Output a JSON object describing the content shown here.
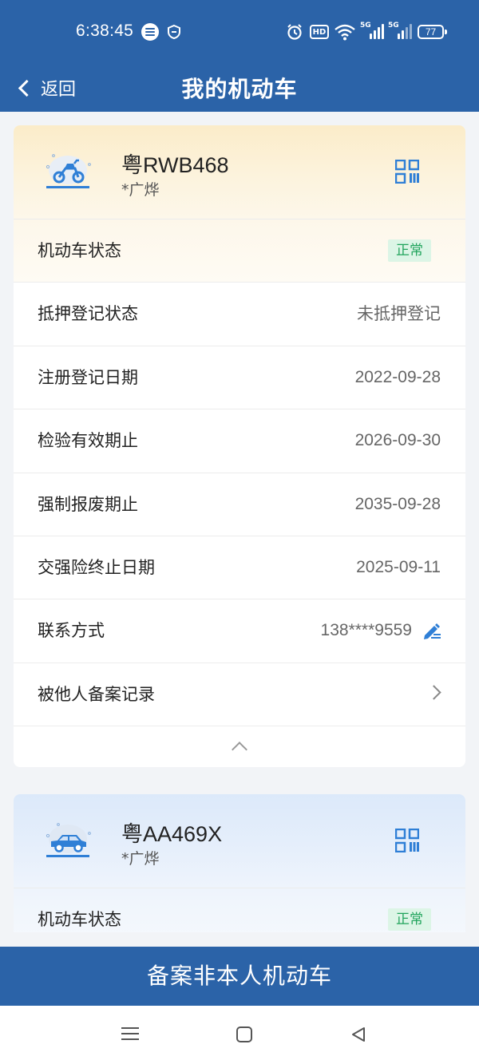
{
  "status_bar": {
    "time": "6:38:45",
    "hd_label": "HD",
    "signal1_label": "5G",
    "signal2_label": "5G",
    "battery": "77"
  },
  "nav": {
    "back_label": "返回",
    "title": "我的机动车"
  },
  "vehicles": [
    {
      "plate": "粤RWB468",
      "owner": "*广烨",
      "icon": "motorcycle-icon",
      "rows": [
        {
          "label": "机动车状态",
          "badge": "正常"
        },
        {
          "label": "抵押登记状态",
          "value": "未抵押登记"
        },
        {
          "label": "注册登记日期",
          "value": "2022-09-28"
        },
        {
          "label": "检验有效期止",
          "value": "2026-09-30"
        },
        {
          "label": "强制报废期止",
          "value": "2035-09-28"
        },
        {
          "label": "交强险终止日期",
          "value": "2025-09-11"
        },
        {
          "label": "联系方式",
          "value": "138****9559"
        },
        {
          "label": "被他人备案记录"
        }
      ]
    },
    {
      "plate": "粤AA469X",
      "owner": "*广烨",
      "icon": "car-icon",
      "rows": [
        {
          "label": "机动车状态",
          "badge": "正常"
        }
      ]
    }
  ],
  "bottom_button": "备案非本人机动车",
  "colors": {
    "brand_blue": "#2b63a8",
    "icon_blue": "#2f7fd6",
    "status_green": "#21a45c",
    "status_green_bg": "#dcf5e6"
  }
}
